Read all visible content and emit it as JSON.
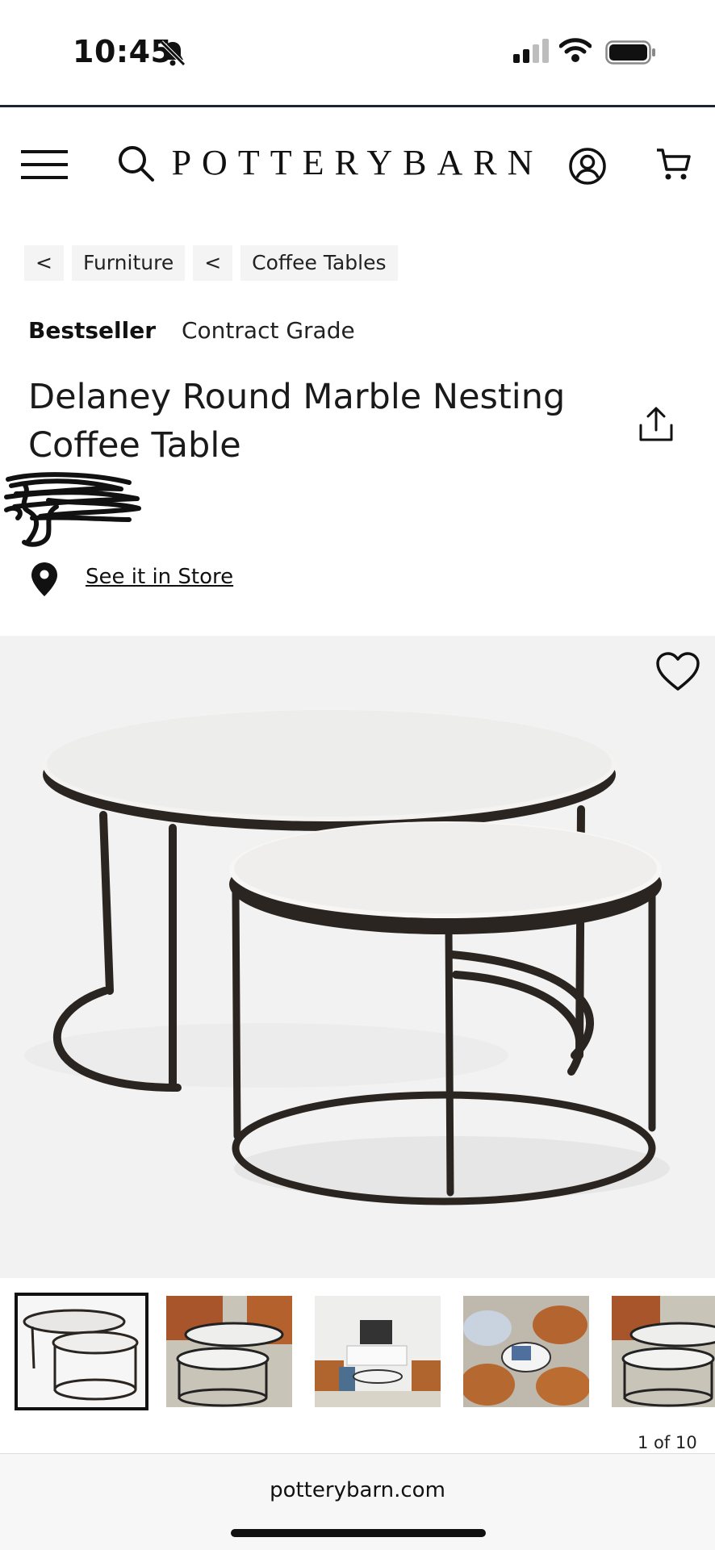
{
  "status_bar": {
    "time": "10:45",
    "icons": [
      "bell-slash-icon",
      "signal-icon",
      "wifi-icon",
      "battery-icon"
    ]
  },
  "header": {
    "logo": "POTTERYBARN",
    "icons": [
      "hamburger-menu-icon",
      "search-icon",
      "account-icon",
      "cart-icon"
    ]
  },
  "breadcrumbs": [
    {
      "back": "<",
      "label": "Furniture"
    },
    {
      "back": "<",
      "label": "Coffee Tables"
    }
  ],
  "product": {
    "tags": [
      "Bestseller",
      "Contract Grade"
    ],
    "title": "Delaney Round Marble Nesting Coffee Table",
    "store_link": "See it in Store"
  },
  "gallery": {
    "counter": "1 of 10",
    "thumbnail_count_visible": 5,
    "selected_index": 0
  },
  "browser": {
    "url": "potterybarn.com"
  },
  "colors": {
    "accent_dark": "#1b2433",
    "crumb_bg": "#f4f4f4",
    "hero_bg": "#f2f2f2",
    "frame_black": "#2a2520"
  }
}
